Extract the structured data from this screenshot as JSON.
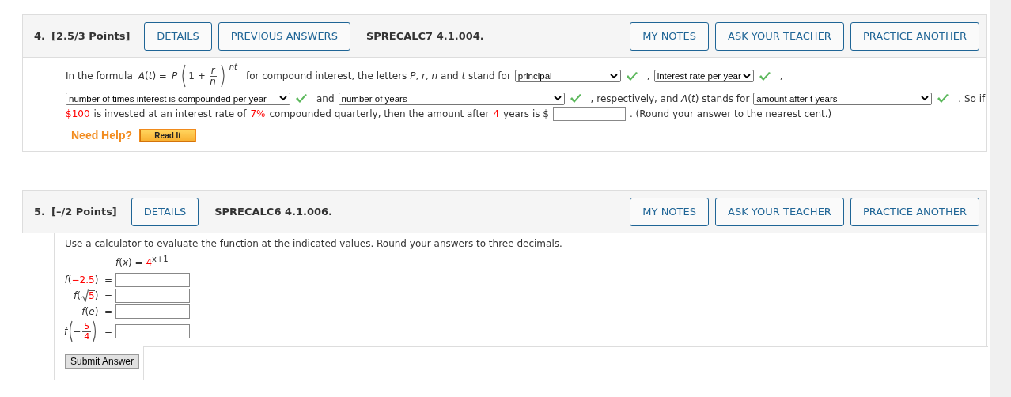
{
  "questions": [
    {
      "number": "4.",
      "points": "[2.5/3 Points]",
      "left_buttons": [
        "DETAILS",
        "PREVIOUS ANSWERS"
      ],
      "code": "SPRECALC7 4.1.004.",
      "right_buttons": [
        "MY NOTES",
        "ASK YOUR TEACHER",
        "PRACTICE ANOTHER"
      ],
      "kind": "fill_in",
      "lines": [
        [
          {
            "kind": "text",
            "text": "In the formula",
            "highlighted": false
          },
          {
            "kind": "formula",
            "lhs": "*A*(*t*) =",
            "coef": "*P*",
            "inner": "1 +",
            "num": "r",
            "den": "n",
            "exp": "nt"
          },
          {
            "kind": "text",
            "text": "for compound interest, the letters *P*, *r*, *n* and *t* stand for",
            "highlighted": false
          },
          {
            "kind": "select",
            "value": "principal",
            "correct": true
          },
          {
            "kind": "text",
            "text": ",",
            "highlighted": false
          },
          {
            "kind": "select",
            "value": "interest rate per year",
            "correct": true
          },
          {
            "kind": "text",
            "text": ",",
            "highlighted": false
          }
        ],
        [
          {
            "kind": "select",
            "value": "number of times interest is compounded per year",
            "correct": true
          },
          {
            "kind": "text",
            "text": "and",
            "highlighted": false
          },
          {
            "kind": "select",
            "value": "number of years",
            "correct": true
          },
          {
            "kind": "text",
            "text": ", respectively, and *A*(*t*) stands for",
            "highlighted": false
          },
          {
            "kind": "select",
            "value": "amount after t years",
            "correct": true
          },
          {
            "kind": "text",
            "text": ". So if",
            "highlighted": false
          }
        ],
        [
          {
            "kind": "text",
            "text": "$100",
            "highlighted": true
          },
          {
            "kind": "text",
            "text": "is invested at an interest rate of",
            "highlighted": false
          },
          {
            "kind": "text",
            "text": "7%",
            "highlighted": true
          },
          {
            "kind": "text",
            "text": "compounded quarterly, then the amount after",
            "highlighted": false
          },
          {
            "kind": "text",
            "text": "4",
            "highlighted": true
          },
          {
            "kind": "text",
            "text": "years is $",
            "highlighted": false
          },
          {
            "kind": "input"
          },
          {
            "kind": "text",
            "text": ". (Round your answer to the nearest cent.)",
            "highlighted": false
          }
        ]
      ],
      "help": {
        "label": "Need Help?",
        "button": "Read It"
      }
    },
    {
      "number": "5.",
      "points": "[–/2 Points]",
      "left_buttons": [
        "DETAILS"
      ],
      "code": "SPRECALC6 4.1.006.",
      "right_buttons": [
        "MY NOTES",
        "ASK YOUR TEACHER",
        "PRACTICE ANOTHER"
      ],
      "kind": "evaluate",
      "instruction": "Use a calculator to evaluate the function at the indicated values. Round your answers to three decimals.",
      "function": {
        "lhs": "*f*(*x*) =",
        "base": "4",
        "exp": "x+1"
      },
      "rows": [
        {
          "kind": "plain",
          "fn": "*f*(",
          "arg": "−2.5",
          "close": ")",
          "arg_highlighted": true,
          "equals": "="
        },
        {
          "kind": "sqrt",
          "fn": "*f*(",
          "arg": "5",
          "close": ")",
          "arg_highlighted": true,
          "equals": "="
        },
        {
          "kind": "plain",
          "fn": "*f*(",
          "arg": "*e*",
          "close": ")",
          "arg_highlighted": false,
          "equals": "="
        },
        {
          "kind": "fraction",
          "fn": "*f*",
          "sign": "−",
          "num": "5",
          "den": "4",
          "equals": "="
        }
      ],
      "submit": "Submit Answer"
    }
  ]
}
